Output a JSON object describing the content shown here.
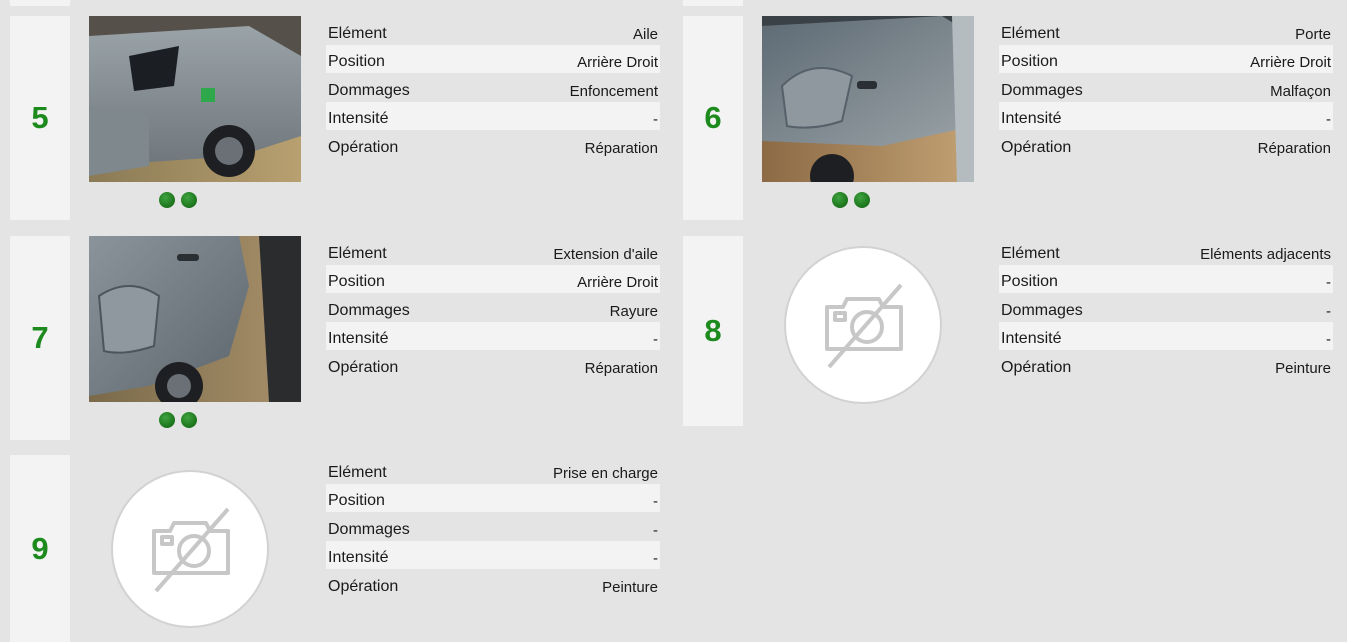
{
  "labels": {
    "element": "Elément",
    "position": "Position",
    "dommages": "Dommages",
    "intensite": "Intensité",
    "operation": "Opération"
  },
  "cards": [
    {
      "number": "5",
      "element": "Aile",
      "position": "Arrière Droit",
      "dommages": "Enfoncement",
      "intensite": "-",
      "operation": "Réparation",
      "photo": "car-rear-wing-photo",
      "photo_dots": 2
    },
    {
      "number": "6",
      "element": "Porte",
      "position": "Arrière Droit",
      "dommages": "Malfaçon",
      "intensite": "-",
      "operation": "Réparation",
      "photo": "car-rear-door-photo",
      "photo_dots": 2
    },
    {
      "number": "7",
      "element": "Extension d'aile",
      "position": "Arrière Droit",
      "dommages": "Rayure",
      "intensite": "-",
      "operation": "Réparation",
      "photo": "car-wheel-arch-photo",
      "photo_dots": 2
    },
    {
      "number": "8",
      "element": "Eléments adjacents",
      "position": "-",
      "dommages": "-",
      "intensite": "-",
      "operation": "Peinture",
      "photo": "no-photo-icon",
      "photo_dots": 0
    },
    {
      "number": "9",
      "element": "Prise en charge",
      "position": "-",
      "dommages": "-",
      "intensite": "-",
      "operation": "Peinture",
      "photo": "no-photo-icon",
      "photo_dots": 0
    }
  ],
  "colors": {
    "accent_green": "#1c8a1c",
    "background": "#e4e4e4",
    "panel": "#f3f3f3"
  }
}
